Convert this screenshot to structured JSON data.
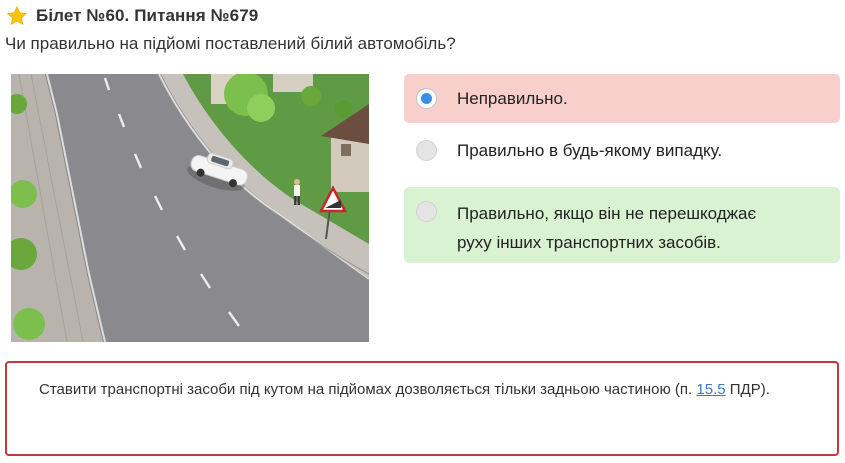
{
  "header": {
    "title": "Білет №60. Питання №679",
    "icon": "star-icon",
    "star_color": "#f7c600"
  },
  "question": {
    "text": "Чи правильно на підйомі поставлений білий автомобіль?"
  },
  "illustration": {
    "description_icon": "road-scene-illustration"
  },
  "answers": [
    {
      "label": "Неправильно.",
      "state": "selected",
      "feedback": "incorrect",
      "bg": "#f8cfcb"
    },
    {
      "label": "Правильно в будь-якому випадку.",
      "state": "unselected",
      "feedback": "none",
      "bg": "#ffffff"
    },
    {
      "label_line1": "Правильно, якщо він не перешкоджає",
      "label_line2": "руху інших транспортних засобів.",
      "state": "unselected",
      "feedback": "correct",
      "bg": "#d9f2d2"
    }
  ],
  "explanation": {
    "text_before": "Ставити транспортні засоби під кутом на підйомах дозволяється тільки задньою частиною (п. ",
    "link_text": "15.5",
    "text_after": " ПДР).",
    "border_color": "#c0393b"
  }
}
